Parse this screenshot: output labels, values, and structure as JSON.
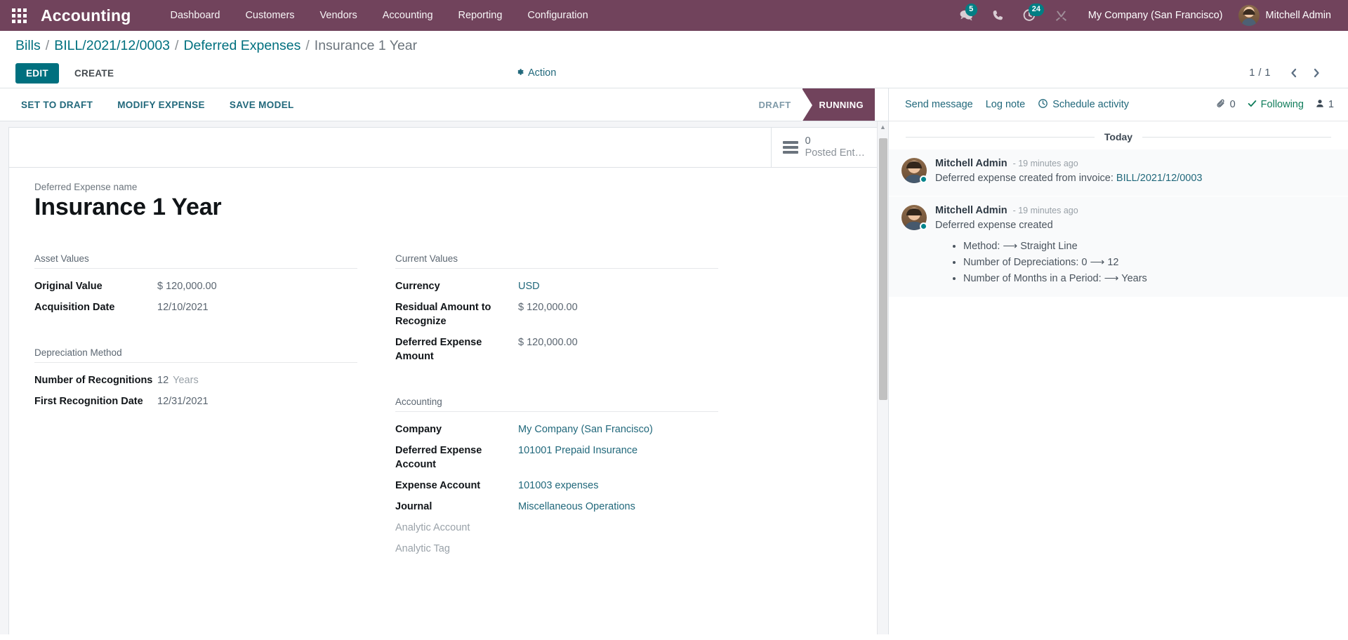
{
  "navbar": {
    "apps_icon": "apps-grid-icon",
    "brand": "Accounting",
    "menu": [
      "Dashboard",
      "Customers",
      "Vendors",
      "Accounting",
      "Reporting",
      "Configuration"
    ],
    "messages_icon": "chat-bubble-icon",
    "messages_count": "5",
    "phone_icon": "phone-icon",
    "activity_icon": "clock-activity-icon",
    "activity_count": "24",
    "debug_icon": "wrench-tools-icon",
    "company": "My Company (San Francisco)",
    "user": "Mitchell Admin",
    "accent": "#71435c",
    "badge_color": "#017e84"
  },
  "control_panel": {
    "breadcrumb": [
      {
        "label": "Bills",
        "active": false
      },
      {
        "label": "BILL/2021/12/0003",
        "active": false
      },
      {
        "label": "Deferred Expenses",
        "active": false
      },
      {
        "label": "Insurance 1 Year",
        "active": true
      }
    ],
    "edit_label": "EDIT",
    "create_label": "CREATE",
    "action_label": "Action",
    "action_icon": "gear-icon",
    "pager": "1 / 1",
    "prev_icon": "chevron-left-icon",
    "next_icon": "chevron-right-icon"
  },
  "statusbar": {
    "buttons": [
      "SET TO DRAFT",
      "MODIFY EXPENSE",
      "SAVE MODEL"
    ],
    "states": [
      {
        "label": "DRAFT",
        "active": false
      },
      {
        "label": "RUNNING",
        "active": true
      }
    ]
  },
  "smart_button": {
    "icon": "bars-list-icon",
    "value": "0",
    "label": "Posted Ent…"
  },
  "form": {
    "title_label": "Deferred Expense name",
    "title_value": "Insurance 1 Year",
    "groups": [
      {
        "title": "Asset Values",
        "column": "left",
        "fields": [
          {
            "label": "Original Value",
            "value": "$ 120,000.00",
            "type": "text",
            "muted_label": false
          },
          {
            "label": "Acquisition Date",
            "value": "12/10/2021",
            "type": "text",
            "muted_label": false
          }
        ]
      },
      {
        "title": "Depreciation Method",
        "column": "left",
        "fields": [
          {
            "label": "Number of Recognitions",
            "value": "12",
            "unit": "Years",
            "type": "text",
            "muted_label": false
          },
          {
            "label": "First Recognition Date",
            "value": "12/31/2021",
            "type": "text",
            "muted_label": false
          }
        ]
      },
      {
        "title": "Current Values",
        "column": "right",
        "fields": [
          {
            "label": "Currency",
            "value": "USD",
            "type": "link",
            "muted_label": false
          },
          {
            "label": "Residual Amount to Recognize",
            "value": "$ 120,000.00",
            "type": "text",
            "muted_label": false
          },
          {
            "label": "Deferred Expense Amount",
            "value": "$ 120,000.00",
            "type": "text",
            "muted_label": false
          }
        ]
      },
      {
        "title": "Accounting",
        "column": "right",
        "fields": [
          {
            "label": "Company",
            "value": "My Company (San Francisco)",
            "type": "link",
            "muted_label": false
          },
          {
            "label": "Deferred Expense Account",
            "value": "101001 Prepaid Insurance",
            "type": "link",
            "muted_label": false
          },
          {
            "label": "Expense Account",
            "value": "101003 expenses",
            "type": "link",
            "muted_label": false
          },
          {
            "label": "Journal",
            "value": "Miscellaneous Operations",
            "type": "link",
            "muted_label": false
          },
          {
            "label": "Analytic Account",
            "value": "",
            "type": "text",
            "muted_label": true
          },
          {
            "label": "Analytic Tag",
            "value": "",
            "type": "text",
            "muted_label": true
          }
        ]
      }
    ]
  },
  "chatter": {
    "send_message": "Send message",
    "log_note": "Log note",
    "schedule_activity": "Schedule activity",
    "schedule_icon": "clock-icon",
    "attachment_icon": "paperclip-icon",
    "attachment_count": "0",
    "follow_icon": "check-icon",
    "follow_label": "Following",
    "followers_icon": "user-icon",
    "followers_count": "1",
    "date_separator": "Today",
    "messages": [
      {
        "author": "Mitchell Admin",
        "time": "- 19 minutes ago",
        "text_before": "Deferred expense created from invoice: ",
        "link": "BILL/2021/12/0003",
        "bullets": []
      },
      {
        "author": "Mitchell Admin",
        "time": "- 19 minutes ago",
        "text_before": "Deferred expense created",
        "link": "",
        "bullets": [
          "Method: ⟶ Straight Line",
          "Number of Depreciations: 0 ⟶ 12",
          "Number of Months in a Period: ⟶ Years"
        ]
      }
    ]
  }
}
